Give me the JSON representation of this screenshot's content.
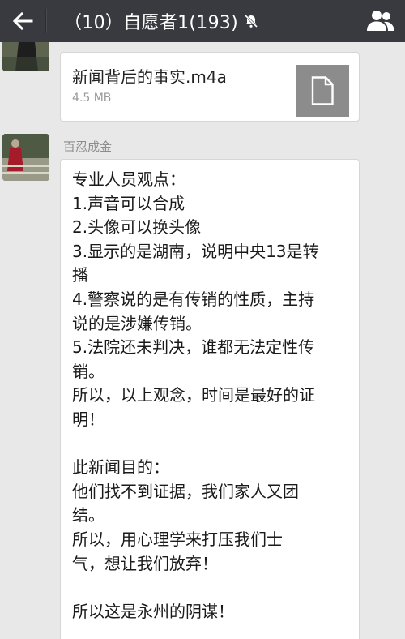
{
  "header": {
    "title": "（10）自愿者1(193)",
    "back_icon": "arrow-left-icon",
    "mute_icon": "bell-slash-icon",
    "members_icon": "group-members-icon"
  },
  "file_message": {
    "file_name": "新闻背后的事实.m4a",
    "file_size": "4.5 MB",
    "icon": "file-document-icon"
  },
  "text_message": {
    "sender": "百忍成金",
    "lines": [
      "专业人员观点：",
      "1.声音可以合成",
      "2.头像可以换头像",
      "3.显示的是湖南，说明中央13是转",
      "播",
      "4.警察说的是有传销的性质，主持",
      "说的是涉嫌传销。",
      "5.法院还未判决，谁都无法定性传",
      "销。",
      "所以，以上观念，时间是最好的证",
      "明！",
      "",
      "此新闻目的：",
      "他们找不到证据，我们家人又团",
      "结。",
      "所以，用心理学来打压我们士",
      "气，想让我们放弃！",
      "",
      "所以这是永州的阴谋！"
    ]
  }
}
